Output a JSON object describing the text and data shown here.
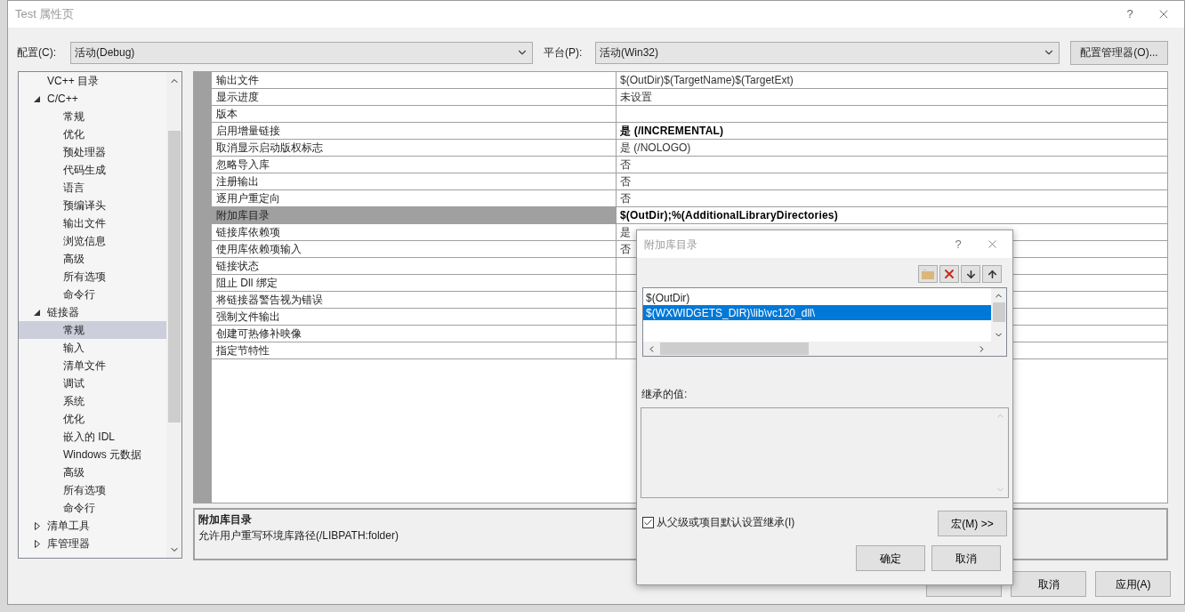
{
  "window": {
    "title": "Test 属性页",
    "help": "?"
  },
  "config": {
    "label": "配置(C):",
    "value": "活动(Debug)"
  },
  "platform": {
    "label": "平台(P):",
    "value": "活动(Win32)"
  },
  "config_manager_button": "配置管理器(O)...",
  "tree": [
    {
      "label": "VC++ 目录",
      "selected": false
    },
    {
      "label": "C/C++",
      "selected": false,
      "expanded": true,
      "children": [
        {
          "label": "常规",
          "selected": false
        },
        {
          "label": "优化",
          "selected": false
        },
        {
          "label": "预处理器",
          "selected": false
        },
        {
          "label": "代码生成",
          "selected": false
        },
        {
          "label": "语言",
          "selected": false
        },
        {
          "label": "预编译头",
          "selected": false
        },
        {
          "label": "输出文件",
          "selected": false
        },
        {
          "label": "浏览信息",
          "selected": false
        },
        {
          "label": "高级",
          "selected": false
        },
        {
          "label": "所有选项",
          "selected": false
        },
        {
          "label": "命令行",
          "selected": false
        }
      ]
    },
    {
      "label": "链接器",
      "selected": false,
      "expanded": true,
      "children": [
        {
          "label": "常规",
          "selected": true
        },
        {
          "label": "输入",
          "selected": false
        },
        {
          "label": "清单文件",
          "selected": false
        },
        {
          "label": "调试",
          "selected": false
        },
        {
          "label": "系统",
          "selected": false
        },
        {
          "label": "优化",
          "selected": false
        },
        {
          "label": "嵌入的 IDL",
          "selected": false
        },
        {
          "label": "Windows 元数据",
          "selected": false
        },
        {
          "label": "高级",
          "selected": false
        },
        {
          "label": "所有选项",
          "selected": false
        },
        {
          "label": "命令行",
          "selected": false
        }
      ]
    },
    {
      "label": "清单工具",
      "selected": false,
      "expanded": false
    },
    {
      "label": "库管理器",
      "selected": false,
      "expanded": false
    }
  ],
  "properties": [
    {
      "name": "输出文件",
      "value": "$(OutDir)$(TargetName)$(TargetExt)",
      "bold": false,
      "selected": false
    },
    {
      "name": "显示进度",
      "value": "未设置",
      "bold": false,
      "selected": false
    },
    {
      "name": "版本",
      "selected": false
    },
    {
      "name": "启用增量链接",
      "value": "是 (/INCREMENTAL)",
      "bold": true,
      "selected": false
    },
    {
      "name": "取消显示启动版权标志",
      "value": "是 (/NOLOGO)",
      "bold": false,
      "selected": false
    },
    {
      "name": "忽略导入库",
      "value": "否",
      "bold": false,
      "selected": false
    },
    {
      "name": "注册输出",
      "value": "否",
      "bold": false,
      "selected": false
    },
    {
      "name": "逐用户重定向",
      "value": "否",
      "bold": false,
      "selected": false
    },
    {
      "name": "附加库目录",
      "value": "$(OutDir);%(AdditionalLibraryDirectories)",
      "bold": true,
      "selected": true
    },
    {
      "name": "链接库依赖项",
      "value": "是",
      "bold": false,
      "selected": false
    },
    {
      "name": "使用库依赖项输入",
      "value": "否",
      "bold": false,
      "selected": false
    },
    {
      "name": "链接状态",
      "selected": false
    },
    {
      "name": "阻止 Dll 绑定",
      "selected": false
    },
    {
      "name": "将链接器警告视为错误",
      "selected": false
    },
    {
      "name": "强制文件输出",
      "selected": false
    },
    {
      "name": "创建可热修补映像",
      "selected": false
    },
    {
      "name": "指定节特性",
      "selected": false
    }
  ],
  "description": {
    "title": "附加库目录",
    "text": "允许用户重写环境库路径(/LIBPATH:folder)"
  },
  "buttons": [
    "取消",
    "应用(A)"
  ],
  "popup": {
    "title": "附加库目录",
    "help": "?",
    "entries": [
      {
        "text": "$(OutDir)",
        "selected": false
      },
      {
        "text": "$(WXWIDGETS_DIR)\\lib\\vc120_dll\\",
        "selected": true
      }
    ],
    "inherited_label": "继承的值:",
    "inherit_checkbox": {
      "label": "从父级或项目默认设置继承(I)",
      "checked": true
    },
    "macros_button": "宏(M) >>",
    "buttons": [
      "确定",
      "取消"
    ]
  }
}
